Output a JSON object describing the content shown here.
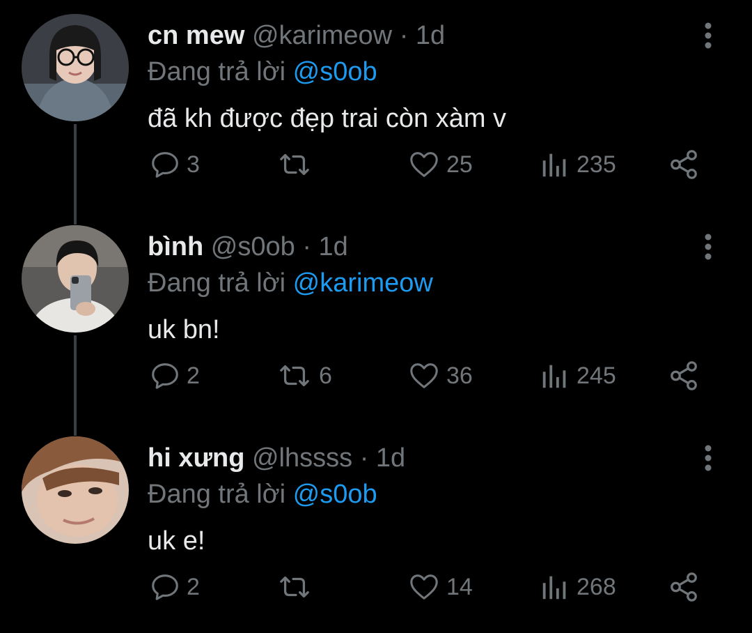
{
  "colors": {
    "background": "#000000",
    "text_primary": "#e7e9ea",
    "text_secondary": "#71767b",
    "mention": "#1d9bf0",
    "thread_line": "#3a3d41"
  },
  "tweets": [
    {
      "name": "cn mew",
      "handle": "@karimeow",
      "dot": "·",
      "time": "1d",
      "reply_prefix": "Đang trả lời",
      "reply_to": "@s0ob",
      "text": "đã kh được đẹp trai còn xàm v",
      "replies": "3",
      "retweets": "",
      "likes": "25",
      "views": "235"
    },
    {
      "name": "bình",
      "handle": "@s0ob",
      "dot": "·",
      "time": "1d",
      "reply_prefix": "Đang trả lời",
      "reply_to": "@karimeow",
      "text": "uk bn!",
      "replies": "2",
      "retweets": "6",
      "likes": "36",
      "views": "245"
    },
    {
      "name": "hi xưng",
      "handle": "@lhssss",
      "dot": "·",
      "time": "1d",
      "reply_prefix": "Đang trả lời",
      "reply_to": "@s0ob",
      "text": "uk e!",
      "replies": "2",
      "retweets": "",
      "likes": "14",
      "views": "268"
    }
  ],
  "icons": {
    "reply": "reply-bubble-icon",
    "retweet": "retweet-icon",
    "like": "heart-icon",
    "views": "analytics-icon",
    "share": "share-icon",
    "more": "more-vertical-icon"
  }
}
